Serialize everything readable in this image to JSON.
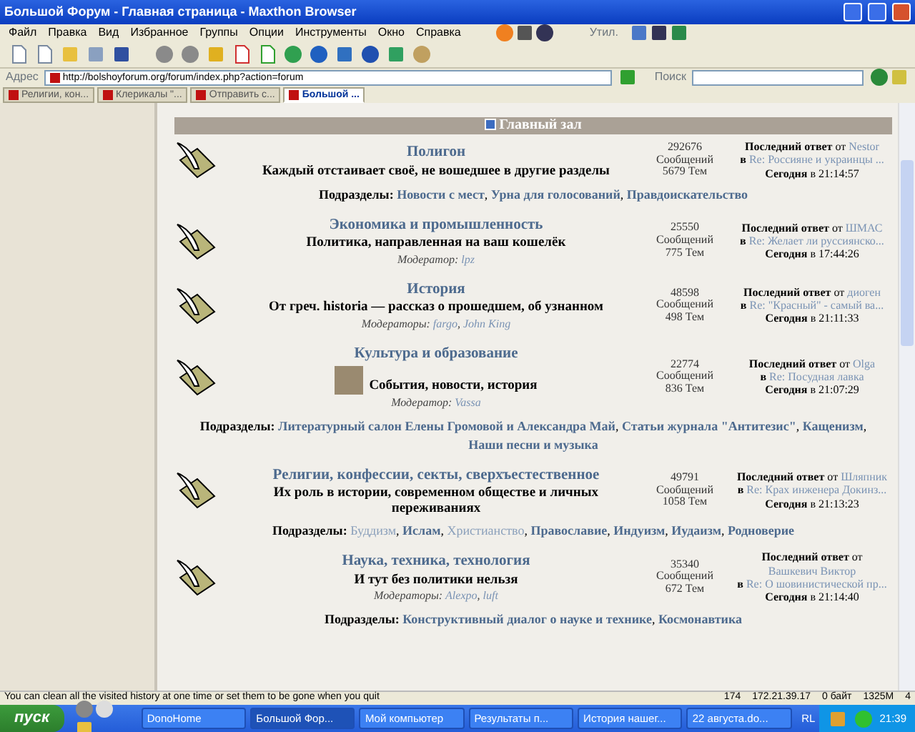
{
  "window": {
    "title": "Большой Форум - Главная страница - Maxthon Browser"
  },
  "menu": [
    "Файл",
    "Правка",
    "Вид",
    "Избранное",
    "Группы",
    "Опции",
    "Инструменты",
    "Окно",
    "Справка"
  ],
  "utilities_label": "Утил.",
  "address": {
    "label": "Адрес",
    "value": "http://bolshoyforum.org/forum/index.php?action=forum"
  },
  "search": {
    "label": "Поиск"
  },
  "tabs": [
    {
      "label": "Религии, кон...",
      "selected": false
    },
    {
      "label": "Клерикалы \"...",
      "selected": false
    },
    {
      "label": "Отправить с...",
      "selected": false
    },
    {
      "label": "Большой ...",
      "selected": true
    }
  ],
  "forum": {
    "section_title": "Главный зал",
    "separator": ", ",
    "boards": [
      {
        "name": "Полигон",
        "description": "Каждый отстаивает своё, не вошедшее в другие разделы",
        "avatar": false,
        "posts": "292676",
        "posts_label": "Сообщений",
        "topics": "5679 Тем",
        "last_reply": "**Последний ответ** от",
        "author": "Nestor",
        "in_label": "в",
        "topic": "Re: Россияне и украинцы ...",
        "date": "**Сегодня** в 21:14:57",
        "subboards_label": "Подразделы:",
        "subboards": [
          {
            "name": "Новости с мест",
            "unread": true
          },
          {
            "name": "Урна для голосований",
            "unread": true
          },
          {
            "name": "Правдоискательство",
            "unread": true
          }
        ]
      },
      {
        "name": "Экономика и промышленность",
        "description": "Политика, направленная на ваш кошелёк",
        "avatar": false,
        "moderators_label": "Модератор:",
        "moderators": [
          "lpz"
        ],
        "posts": "25550",
        "posts_label": "Сообщений",
        "topics": "775 Тем",
        "last_reply": "**Последний ответ** от",
        "author": "ШМАС",
        "in_label": "в",
        "topic": "Re: Желает ли руссиянско...",
        "date": "**Сегодня** в 17:44:26"
      },
      {
        "name": "История",
        "description": "От греч. historia — рассказ о прошедшем, об узнанном",
        "avatar": false,
        "moderators_label": "Модераторы:",
        "moderators": [
          "fargo",
          "John King"
        ],
        "posts": "48598",
        "posts_label": "Сообщений",
        "topics": "498 Тем",
        "last_reply": "**Последний ответ** от",
        "author": "диоген",
        "in_label": "в",
        "topic": "Re: \"Красный\" - самый ва...",
        "date": "**Сегодня** в 21:11:33"
      },
      {
        "name": "Культура и образование",
        "description": "События, новости, история",
        "avatar": true,
        "moderators_label": "Модератор:",
        "moderators": [
          "Vassa"
        ],
        "posts": "22774",
        "posts_label": "Сообщений",
        "topics": "836 Тем",
        "last_reply": "**Последний ответ** от",
        "author": "Olga",
        "in_label": "в",
        "topic": "Re: Посудная лавка",
        "date": "**Сегодня** в 21:07:29",
        "subboards_label": "Подразделы:",
        "subboards": [
          {
            "name": "Литературный салон Елены Громовой и Александра Май",
            "unread": true
          },
          {
            "name": "Статьи журнала \"Антитезис\"",
            "unread": true
          },
          {
            "name": "Кащенизм",
            "unread": true
          },
          {
            "name": "Наши песни и музыка",
            "unread": true
          }
        ]
      },
      {
        "name": "Религии, конфессии, секты, сверхъестественное",
        "description": "Их роль в истории, современном обществе и личных переживаниях",
        "avatar": false,
        "posts": "49791",
        "posts_label": "Сообщений",
        "topics": "1058 Тем",
        "last_reply": "**Последний ответ** от",
        "author": "Шляпник",
        "in_label": "в",
        "topic": "Re: Крах инженера Докинз...",
        "date": "**Сегодня** в 21:13:23",
        "subboards_label": "Подразделы:",
        "subboards": [
          {
            "name": "Буддизм",
            "unread": false
          },
          {
            "name": "Ислам",
            "unread": true
          },
          {
            "name": "Христианство",
            "unread": false
          },
          {
            "name": "Православие",
            "unread": true
          },
          {
            "name": "Индуизм",
            "unread": true
          },
          {
            "name": "Иудаизм",
            "unread": true
          },
          {
            "name": "Родноверие",
            "unread": true
          }
        ]
      },
      {
        "name": "Наука, техника, технология",
        "description": "И тут без политики нельзя",
        "avatar": false,
        "moderators_label": "Модераторы:",
        "moderators": [
          "Alexpo",
          "luft"
        ],
        "posts": "35340",
        "posts_label": "Сообщений",
        "topics": "672 Тем",
        "last_reply": "**Последний ответ** от",
        "author": "Вашкевич Виктор",
        "in_label": "в",
        "topic": "Re: О шовинистической пр...",
        "date": "**Сегодня** в 21:14:40",
        "subboards_label": "Подразделы:",
        "subboards": [
          {
            "name": "Конструктивный диалог о науке и технике",
            "unread": true
          },
          {
            "name": "Космонавтика",
            "unread": true
          }
        ]
      }
    ]
  },
  "status_bar": {
    "message": "You can clean all the visited history at one time or set them to be gone when you quit",
    "count": "174",
    "ip": "172.21.39.17",
    "traffic": "0 байт",
    "memory": "1325M",
    "extra": "4"
  },
  "taskbar": {
    "start": "пуск",
    "items": [
      {
        "label": "DonoHome",
        "selected": false
      },
      {
        "label": "Большой Фор...",
        "selected": true
      },
      {
        "label": "Мой компьютер",
        "selected": false
      },
      {
        "label": "Результаты п...",
        "selected": false
      },
      {
        "label": "История нашег...",
        "selected": false
      },
      {
        "label": "22 августа.do...",
        "selected": false
      }
    ],
    "language": "RL",
    "clock": "21:39"
  }
}
